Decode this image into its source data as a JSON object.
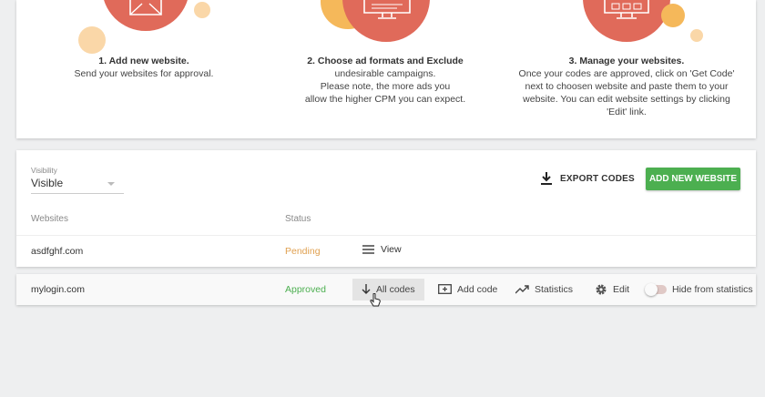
{
  "steps": [
    {
      "title": "1. Add new website.",
      "lines": [
        "Send your websites for approval."
      ]
    },
    {
      "title": "2. Choose ad formats and Exclude",
      "lines": [
        "undesirable campaigns.",
        "Please note, the more ads you",
        "allow the higher CPM you can expect."
      ]
    },
    {
      "title": "3. Manage your websites.",
      "lines": [
        "Once your codes are approved, click on 'Get Code'",
        "next to choosen website and paste them to your",
        "website. You can edit website settings by clicking",
        "'Edit' link."
      ]
    }
  ],
  "filters": {
    "visibility_label": "Visibility",
    "visibility_value": "Visible"
  },
  "toolbar": {
    "export_label": "EXPORT CODES",
    "add_label": "ADD NEW WEBSITE"
  },
  "table": {
    "headers": {
      "websites": "Websites",
      "status": "Status"
    },
    "rows": [
      {
        "website": "asdfghf.com",
        "status": "Pending",
        "actions": {
          "view": "View"
        }
      },
      {
        "website": "mylogin.com",
        "status": "Approved",
        "actions": {
          "all_codes": "All codes",
          "add_code": "Add code",
          "statistics": "Statistics",
          "edit": "Edit",
          "hide": "Hide from statistics"
        }
      }
    ]
  },
  "colors": {
    "accent_red": "#e06a5a",
    "accent_orange": "#f5b85a",
    "accent_peach": "#fad7a8",
    "add_button": "#4caf50",
    "pending": "#e0a050",
    "approved": "#4caf50"
  },
  "icons": [
    "envelope-icon",
    "monitor-icon",
    "dashboard-icon",
    "download-icon",
    "list-icon",
    "arrow-down-icon",
    "add-code-icon",
    "statistics-icon",
    "gear-icon",
    "pointer-cursor"
  ]
}
